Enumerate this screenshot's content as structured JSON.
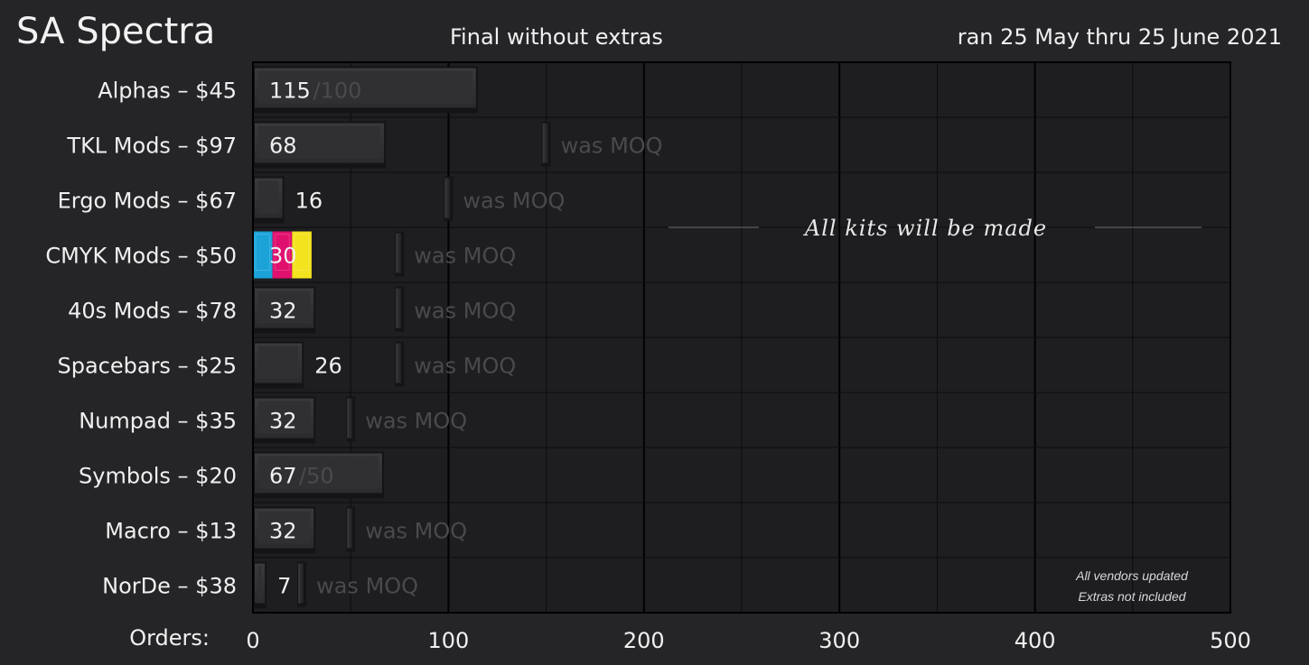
{
  "header": {
    "title": "SA Spectra",
    "subtitle": "Final without extras",
    "dates": "ran 25 May thru 25 June 2021"
  },
  "chart_data": {
    "type": "bar",
    "orientation": "horizontal",
    "xlabel": "Orders:",
    "xlim": [
      0,
      500
    ],
    "xticks": [
      0,
      100,
      200,
      300,
      400,
      500
    ],
    "grid": true,
    "categories": [
      "Alphas – $45",
      "TKL Mods – $97",
      "Ergo Mods – $67",
      "CMYK Mods – $50",
      "40s Mods – $78",
      "Spacebars – $25",
      "Numpad – $35",
      "Symbols – $20",
      "Macro – $13",
      "NorDe – $38"
    ],
    "series": [
      {
        "values": [
          115,
          68,
          16,
          30,
          32,
          26,
          32,
          67,
          32,
          7
        ]
      }
    ],
    "moq": [
      100,
      150,
      100,
      75,
      75,
      75,
      50,
      50,
      50,
      25
    ],
    "moq_status": [
      "met",
      "was",
      "was",
      "was",
      "was",
      "was",
      "was",
      "met",
      "was",
      "was"
    ],
    "labels": [
      "115",
      "68",
      "16",
      "30",
      "32",
      "26",
      "32",
      "67",
      "32",
      "7"
    ],
    "moq_labels": [
      "/100",
      "was MOQ",
      "was MOQ",
      "was MOQ",
      "was MOQ",
      "was MOQ",
      "was MOQ",
      "/50",
      "was MOQ",
      "was MOQ"
    ],
    "annotations": {
      "main": "All kits will be made",
      "note_line1": "All vendors updated",
      "note_line2": "Extras not included"
    },
    "colors": {
      "background": "#252528",
      "plot_bg": "#1e1e21",
      "bar": "#2e2e31",
      "grid": "#000000",
      "text": "#f0f0f0",
      "moq_text": "#4a4a4d",
      "cmyk": [
        "#1ba3d8",
        "#e0106e",
        "#f3e21e"
      ]
    }
  }
}
